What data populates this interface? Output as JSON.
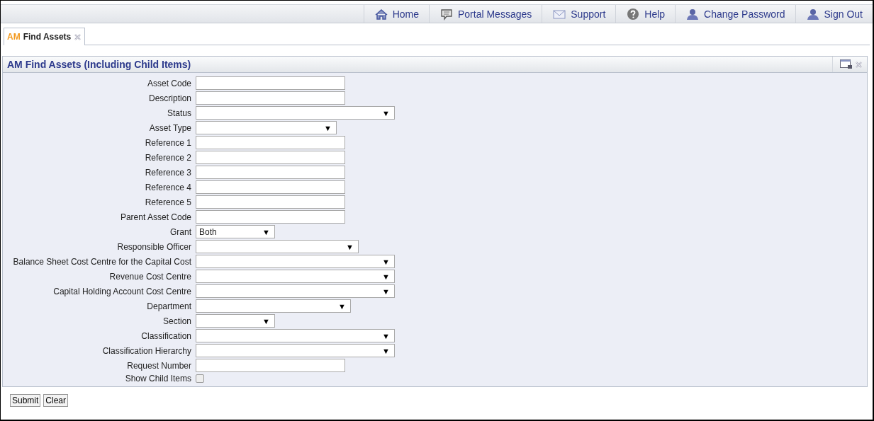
{
  "nav": [
    {
      "label": "Home"
    },
    {
      "label": "Portal Messages"
    },
    {
      "label": "Support"
    },
    {
      "label": "Help"
    },
    {
      "label": "Change Password"
    },
    {
      "label": "Sign Out"
    }
  ],
  "tabs": [
    {
      "prefix": "AM",
      "label": "Find Assets",
      "selected": true
    }
  ],
  "panel": {
    "title": "AM Find Assets (Including Child Items)"
  },
  "fields": [
    {
      "label": "Asset Code",
      "kind": "text"
    },
    {
      "label": "Description",
      "kind": "text"
    },
    {
      "label": "Status",
      "kind": "select"
    },
    {
      "label": "Asset Type",
      "kind": "select"
    },
    {
      "label": "Reference 1",
      "kind": "text"
    },
    {
      "label": "Reference 2",
      "kind": "text"
    },
    {
      "label": "Reference 3",
      "kind": "text"
    },
    {
      "label": "Reference 4",
      "kind": "text"
    },
    {
      "label": "Reference 5",
      "kind": "text"
    },
    {
      "label": "Parent Asset Code",
      "kind": "text"
    },
    {
      "label": "Grant",
      "kind": "select",
      "value": "Both"
    },
    {
      "label": "Responsible Officer",
      "kind": "select"
    },
    {
      "label": "Balance Sheet Cost Centre for the Capital Cost",
      "kind": "select"
    },
    {
      "label": "Revenue Cost Centre",
      "kind": "select"
    },
    {
      "label": "Capital Holding Account Cost Centre",
      "kind": "select"
    },
    {
      "label": "Department",
      "kind": "select"
    },
    {
      "label": "Section",
      "kind": "select"
    },
    {
      "label": "Classification",
      "kind": "select"
    },
    {
      "label": "Classification Hierarchy",
      "kind": "select"
    },
    {
      "label": "Request Number",
      "kind": "text"
    },
    {
      "label": "Show Child Items",
      "kind": "checkbox",
      "checked": false
    }
  ],
  "buttons": [
    "Submit",
    "Clear"
  ],
  "arrow": "▼"
}
